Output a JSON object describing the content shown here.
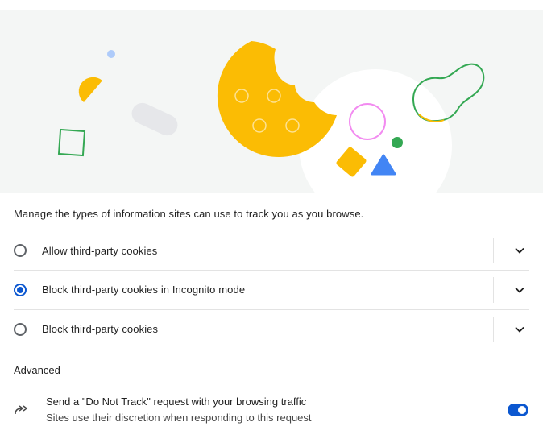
{
  "hero": {
    "illustration": "cookie-illustration",
    "colors": {
      "background": "#f4f6f5",
      "cookie": "#fbbc04",
      "blue": "#4285f4",
      "green": "#34a853",
      "pink": "#f28bf0",
      "light_blue": "#aecbfa",
      "gray": "#e6e7ea"
    }
  },
  "description": "Manage the types of information sites can use to track you as you browse.",
  "options": [
    {
      "label": "Allow third-party cookies",
      "selected": false,
      "icon": "chevron-down-icon"
    },
    {
      "label": "Block third-party cookies in Incognito mode",
      "selected": true,
      "icon": "chevron-down-icon"
    },
    {
      "label": "Block third-party cookies",
      "selected": false,
      "icon": "chevron-down-icon"
    }
  ],
  "advanced": {
    "heading": "Advanced",
    "do_not_track": {
      "icon": "redirect-arrow-icon",
      "title": "Send a \"Do Not Track\" request with your browsing traffic",
      "subtitle": "Sites use their discretion when responding to this request",
      "enabled": true
    }
  },
  "colors": {
    "accent": "#0b57d0",
    "divider": "#e3e3e3",
    "text": "#1f1f1f",
    "secondary_text": "#474747"
  }
}
